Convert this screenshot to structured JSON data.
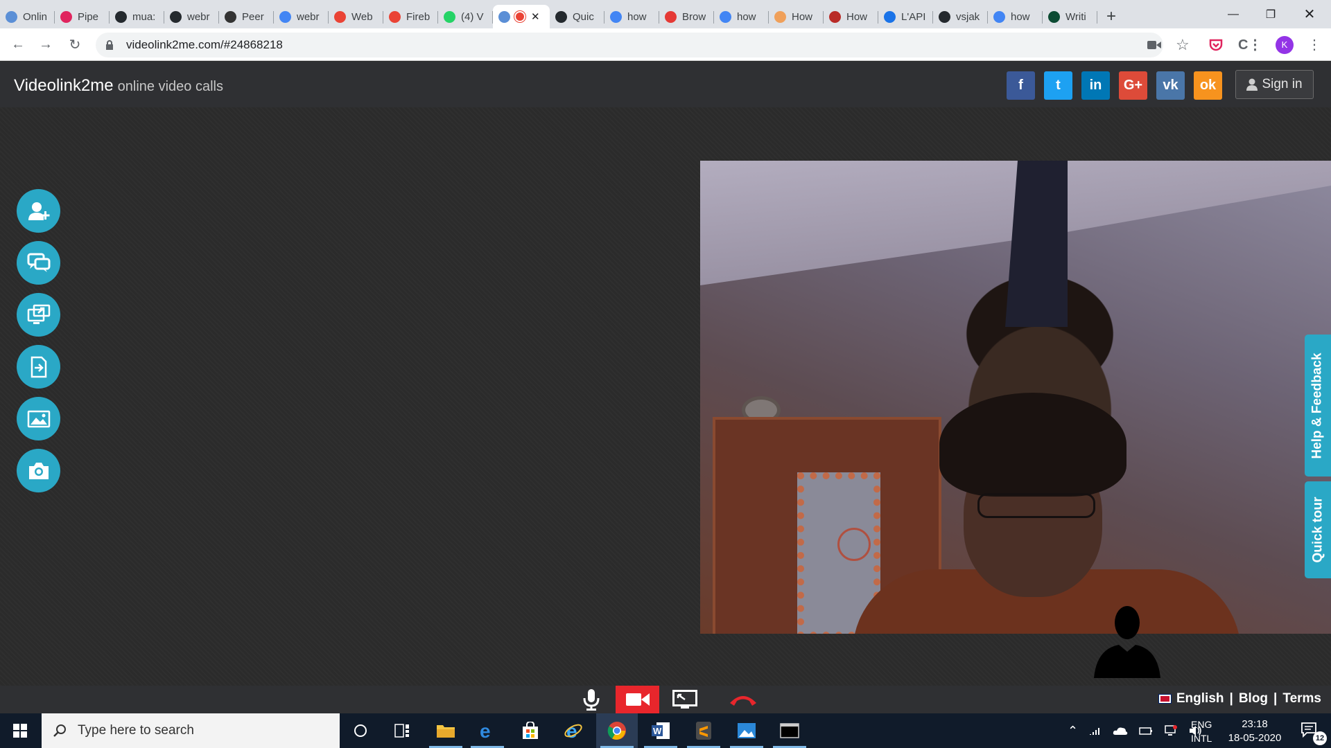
{
  "browser": {
    "tabs": [
      {
        "title": "Onlin",
        "icon": "videolink-icon",
        "color": "#5b8fd6"
      },
      {
        "title": "Pipe",
        "icon": "pipe-icon",
        "color": "#e0245e"
      },
      {
        "title": "mua:",
        "icon": "github-icon",
        "color": "#24292e"
      },
      {
        "title": "webr",
        "icon": "github-icon",
        "color": "#24292e"
      },
      {
        "title": "Peer",
        "icon": "peer-icon",
        "color": "#333333"
      },
      {
        "title": "webr",
        "icon": "google-icon",
        "color": "#4285f4"
      },
      {
        "title": "Web",
        "icon": "chrome-icon",
        "color": "#ea4335"
      },
      {
        "title": "Fireb",
        "icon": "chrome-icon",
        "color": "#ea4335"
      },
      {
        "title": "(4) V",
        "icon": "whatsapp-icon",
        "color": "#25d366"
      },
      {
        "title": "",
        "icon": "videolink-icon",
        "color": "#5b8fd6",
        "active": true
      },
      {
        "title": "Quic",
        "icon": "github-icon",
        "color": "#24292e"
      },
      {
        "title": "how",
        "icon": "google-icon",
        "color": "#4285f4"
      },
      {
        "title": "Brow",
        "icon": "browserling-icon",
        "color": "#e53935"
      },
      {
        "title": "how",
        "icon": "google-icon",
        "color": "#4285f4"
      },
      {
        "title": "How",
        "icon": "howto-icon",
        "color": "#f0a05a"
      },
      {
        "title": "How",
        "icon": "quora-icon",
        "color": "#b92b27"
      },
      {
        "title": "L'API",
        "icon": "mdn-icon",
        "color": "#1a73e8"
      },
      {
        "title": "vsjak",
        "icon": "github-icon",
        "color": "#24292e"
      },
      {
        "title": "how",
        "icon": "google-icon",
        "color": "#4285f4"
      },
      {
        "title": "Writi",
        "icon": "django-icon",
        "color": "#0c4b33"
      }
    ],
    "url": "videolink2me.com/#24868218",
    "profile_initial": "K"
  },
  "site": {
    "brand": "Videolink2me",
    "tagline": "online video calls",
    "sign_in": "Sign in",
    "socials": [
      {
        "name": "facebook",
        "glyph": "f",
        "color": "#3b5998"
      },
      {
        "name": "twitter",
        "glyph": "t",
        "color": "#1da1f2"
      },
      {
        "name": "linkedin",
        "glyph": "in",
        "color": "#0077b5"
      },
      {
        "name": "google-plus",
        "glyph": "G+",
        "color": "#dd4b39"
      },
      {
        "name": "vk",
        "glyph": "vk",
        "color": "#4a76a8"
      },
      {
        "name": "odnoklassniki",
        "glyph": "ok",
        "color": "#f7931e"
      }
    ],
    "accent": "#2aa8c6",
    "help_feedback": "Help & Feedback",
    "quick_tour": "Quick tour",
    "footer_links": {
      "language": "English",
      "blog": "Blog",
      "terms": "Terms",
      "sep": "|"
    }
  },
  "taskbar": {
    "search_placeholder": "Type here to search",
    "lang_top": "ENG",
    "lang_bottom": "INTL",
    "time": "23:18",
    "date": "18-05-2020",
    "notifications": "12"
  }
}
